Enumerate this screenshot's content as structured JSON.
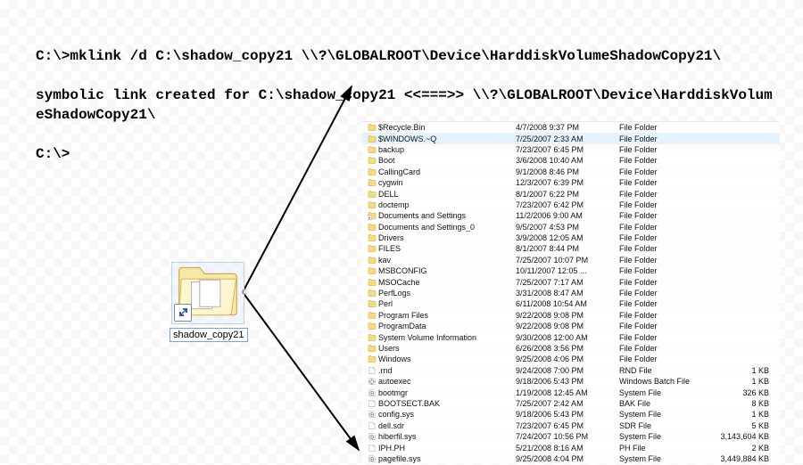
{
  "cmd": {
    "line1": "C:\\>mklink /d C:\\shadow_copy21 \\\\?\\GLOBALROOT\\Device\\HarddiskVolumeShadowCopy21\\",
    "line2": "symbolic link created for C:\\shadow_copy21 <<===>> \\\\?\\GLOBALROOT\\Device\\HarddiskVolumeShadowCopy21\\",
    "line3": "C:\\>"
  },
  "shortcut": {
    "label": "shadow_copy21"
  },
  "files": [
    {
      "icon": "folder",
      "name": "$Recycle.Bin",
      "date": "4/7/2008 9:37 PM",
      "type": "File Folder",
      "size": ""
    },
    {
      "icon": "folder",
      "name": "$WINDOWS.~Q",
      "date": "7/25/2007 2:33 AM",
      "type": "File Folder",
      "size": "",
      "selected": true
    },
    {
      "icon": "folder",
      "name": "backup",
      "date": "7/23/2007 6:45 PM",
      "type": "File Folder",
      "size": ""
    },
    {
      "icon": "folder",
      "name": "Boot",
      "date": "3/6/2008 10:40 AM",
      "type": "File Folder",
      "size": ""
    },
    {
      "icon": "folder",
      "name": "CallingCard",
      "date": "9/1/2008 8:46 PM",
      "type": "File Folder",
      "size": ""
    },
    {
      "icon": "folder",
      "name": "cygwin",
      "date": "12/3/2007 6:39 PM",
      "type": "File Folder",
      "size": ""
    },
    {
      "icon": "folder",
      "name": "DELL",
      "date": "8/1/2007 6:22 PM",
      "type": "File Folder",
      "size": ""
    },
    {
      "icon": "folder",
      "name": "doctemp",
      "date": "7/23/2007 6:42 PM",
      "type": "File Folder",
      "size": ""
    },
    {
      "icon": "link",
      "name": "Documents and Settings",
      "date": "11/2/2006 9:00 AM",
      "type": "File Folder",
      "size": ""
    },
    {
      "icon": "folder",
      "name": "Documents and Settings_0",
      "date": "9/5/2007 4:53 PM",
      "type": "File Folder",
      "size": ""
    },
    {
      "icon": "folder",
      "name": "Drivers",
      "date": "3/9/2008 12:05 AM",
      "type": "File Folder",
      "size": ""
    },
    {
      "icon": "folder",
      "name": "FILES",
      "date": "8/1/2007 8:44 PM",
      "type": "File Folder",
      "size": ""
    },
    {
      "icon": "folder",
      "name": "kav",
      "date": "7/25/2007 10:07 PM",
      "type": "File Folder",
      "size": ""
    },
    {
      "icon": "folder",
      "name": "MSBCONFIG",
      "date": "10/11/2007 12:05 ...",
      "type": "File Folder",
      "size": ""
    },
    {
      "icon": "folder",
      "name": "MSOCache",
      "date": "7/25/2007 7:17 AM",
      "type": "File Folder",
      "size": ""
    },
    {
      "icon": "folder",
      "name": "PerfLogs",
      "date": "3/31/2008 8:47 AM",
      "type": "File Folder",
      "size": ""
    },
    {
      "icon": "folder",
      "name": "Perl",
      "date": "6/11/2008 10:54 AM",
      "type": "File Folder",
      "size": ""
    },
    {
      "icon": "folder",
      "name": "Program Files",
      "date": "9/22/2008 9:08 PM",
      "type": "File Folder",
      "size": ""
    },
    {
      "icon": "folder",
      "name": "ProgramData",
      "date": "9/22/2008 9:08 PM",
      "type": "File Folder",
      "size": ""
    },
    {
      "icon": "folder",
      "name": "System Volume Information",
      "date": "9/30/2008 12:00 AM",
      "type": "File Folder",
      "size": ""
    },
    {
      "icon": "folder",
      "name": "Users",
      "date": "6/26/2008 3:56 PM",
      "type": "File Folder",
      "size": ""
    },
    {
      "icon": "folder",
      "name": "Windows",
      "date": "9/25/2008 4:06 PM",
      "type": "File Folder",
      "size": ""
    },
    {
      "icon": "file",
      "name": ".rnd",
      "date": "9/24/2008 7:00 PM",
      "type": "RND File",
      "size": "1 KB"
    },
    {
      "icon": "batch",
      "name": "autoexec",
      "date": "9/18/2006 5:43 PM",
      "type": "Windows Batch File",
      "size": "1 KB"
    },
    {
      "icon": "sys",
      "name": "bootmgr",
      "date": "1/19/2008 12:45 AM",
      "type": "System File",
      "size": "326 KB"
    },
    {
      "icon": "file",
      "name": "BOOTSECT.BAK",
      "date": "7/25/2007 2:42 AM",
      "type": "BAK File",
      "size": "8 KB"
    },
    {
      "icon": "sys",
      "name": "config.sys",
      "date": "9/18/2006 5:43 PM",
      "type": "System File",
      "size": "1 KB"
    },
    {
      "icon": "file",
      "name": "dell.sdr",
      "date": "7/23/2007 6:45 PM",
      "type": "SDR File",
      "size": "5 KB"
    },
    {
      "icon": "sys",
      "name": "hiberfil.sys",
      "date": "7/24/2007 10:56 PM",
      "type": "System File",
      "size": "3,143,604 KB"
    },
    {
      "icon": "file",
      "name": "IPH.PH",
      "date": "5/21/2008 8:16 AM",
      "type": "PH File",
      "size": "2 KB"
    },
    {
      "icon": "sys",
      "name": "pagefile.sys",
      "date": "9/25/2008 4:04 PM",
      "type": "System File",
      "size": "3,449,884 KB"
    }
  ]
}
